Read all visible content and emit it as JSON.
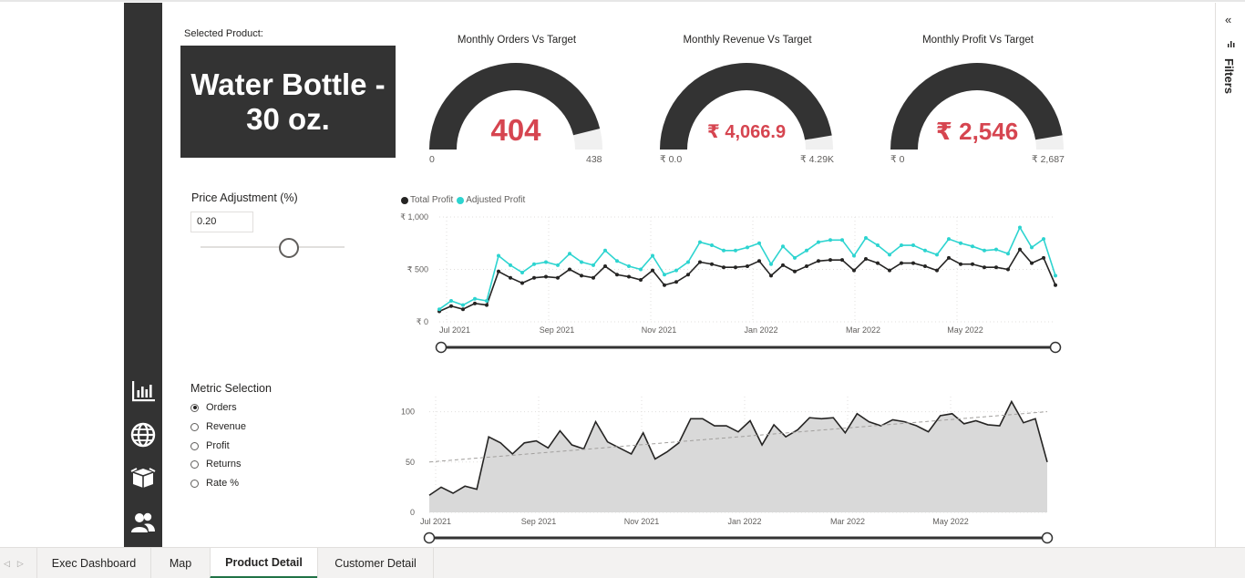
{
  "selected_product": {
    "label": "Selected Product:",
    "name": "Water Bottle - 30 oz."
  },
  "gauges": [
    {
      "title": "Monthly Orders Vs Target",
      "value": "404",
      "min": "0",
      "max": "438",
      "fraction": 0.922
    },
    {
      "title": "Monthly Revenue Vs Target",
      "value": "₹ 4,066.9",
      "min": "₹ 0.0",
      "max": "₹ 4.29K",
      "fraction": 0.948
    },
    {
      "title": "Monthly Profit Vs Target",
      "value": "₹ 2,546",
      "min": "₹ 0",
      "max": "₹ 2,687",
      "fraction": 0.947
    }
  ],
  "price_adjustment": {
    "title": "Price Adjustment (%)",
    "value": "0.20",
    "slider_fraction": 0.62
  },
  "metric_selection": {
    "title": "Metric Selection",
    "options": [
      "Orders",
      "Revenue",
      "Profit",
      "Returns",
      "Rate %"
    ],
    "selected": "Orders"
  },
  "filters": {
    "label": "Filters",
    "collapse_icon": "double-chevron-left-icon",
    "filter_icon": "funnel-bars-icon"
  },
  "nav_icons": [
    "bar-chart-icon",
    "globe-icon",
    "box-icon",
    "users-icon"
  ],
  "tabs": [
    {
      "label": "Exec Dashboard",
      "active": false
    },
    {
      "label": "Map",
      "active": false
    },
    {
      "label": "Product Detail",
      "active": true
    },
    {
      "label": "Customer Detail",
      "active": false
    }
  ],
  "colors": {
    "dark": "#333333",
    "accent_red": "#d64550",
    "teal": "#2dd4d0",
    "area_fill": "#d9d9d9"
  },
  "chart_data": [
    {
      "type": "line",
      "legend": [
        "Total Profit",
        "Adjusted Profit"
      ],
      "legend_position": "top-left",
      "x_tick_labels": [
        "Jul 2021",
        "Sep 2021",
        "Nov 2021",
        "Jan 2022",
        "Mar 2022",
        "May 2022"
      ],
      "y_tick_labels": [
        "₹ 0",
        "₹ 500",
        "₹ 1,000"
      ],
      "ylim": [
        0,
        1000
      ],
      "grid": true,
      "series": [
        {
          "name": "Total Profit",
          "color": "#252423",
          "values": [
            100,
            150,
            120,
            175,
            160,
            480,
            420,
            370,
            420,
            430,
            420,
            500,
            440,
            420,
            530,
            450,
            430,
            400,
            490,
            350,
            380,
            450,
            570,
            550,
            520,
            520,
            530,
            580,
            440,
            540,
            480,
            530,
            580,
            590,
            590,
            490,
            600,
            560,
            490,
            560,
            560,
            530,
            490,
            610,
            550,
            550,
            520,
            520,
            500,
            690,
            560,
            610,
            350
          ]
        },
        {
          "name": "Adjusted Profit",
          "color": "#2dd4d0",
          "values": [
            120,
            200,
            160,
            220,
            200,
            630,
            540,
            470,
            550,
            570,
            540,
            650,
            570,
            540,
            680,
            580,
            530,
            500,
            630,
            450,
            490,
            570,
            760,
            730,
            680,
            680,
            710,
            750,
            550,
            720,
            610,
            680,
            760,
            780,
            780,
            630,
            800,
            730,
            640,
            730,
            730,
            680,
            640,
            790,
            750,
            720,
            680,
            690,
            650,
            900,
            710,
            790,
            440
          ]
        }
      ]
    },
    {
      "type": "area",
      "x_tick_labels": [
        "Jul 2021",
        "Sep 2021",
        "Nov 2021",
        "Jan 2022",
        "Mar 2022",
        "May 2022"
      ],
      "y_tick_labels": [
        "0",
        "50",
        "100"
      ],
      "ylim": [
        0,
        115
      ],
      "grid": true,
      "trend_line": [
        50,
        100
      ],
      "series": [
        {
          "name": "Orders",
          "values": [
            17,
            25,
            19,
            26,
            23,
            75,
            69,
            58,
            69,
            71,
            64,
            81,
            67,
            63,
            90,
            70,
            64,
            58,
            79,
            53,
            60,
            69,
            93,
            93,
            86,
            86,
            80,
            91,
            67,
            87,
            75,
            82,
            94,
            93,
            94,
            79,
            98,
            90,
            86,
            92,
            90,
            86,
            80,
            96,
            98,
            88,
            91,
            87,
            86,
            110,
            89,
            93,
            50
          ]
        }
      ]
    }
  ]
}
